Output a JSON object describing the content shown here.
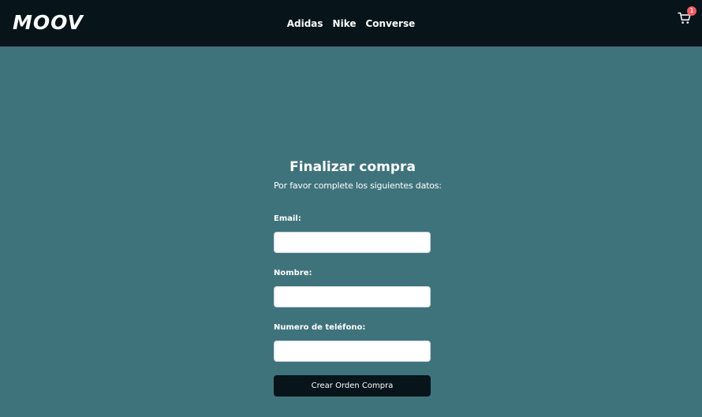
{
  "navbar": {
    "brand": "MOOV",
    "links": [
      {
        "label": "Adidas"
      },
      {
        "label": "Nike"
      },
      {
        "label": "Converse"
      }
    ],
    "cart": {
      "icon": "cart-icon",
      "count": "1"
    }
  },
  "checkout": {
    "title": "Finalizar compra",
    "subtitle": "Por favor complete los siguientes datos:",
    "fields": {
      "email": {
        "label": "Email:",
        "value": "",
        "placeholder": ""
      },
      "nombre": {
        "label": "Nombre:",
        "value": "",
        "placeholder": ""
      },
      "telefono": {
        "label": "Numero de teléfono:",
        "value": "",
        "placeholder": ""
      }
    },
    "submit_label": "Crear Orden Compra"
  },
  "colors": {
    "navbar_bg": "#07141a",
    "page_bg": "#3f737c",
    "badge": "#e85d64",
    "button_bg": "#07141a"
  }
}
